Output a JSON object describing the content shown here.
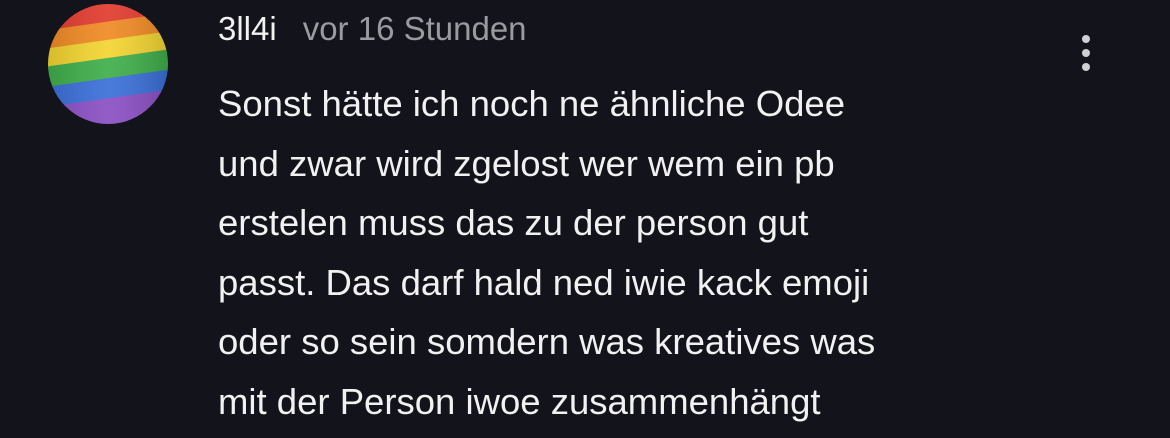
{
  "comment": {
    "avatar_icon": "rainbow-flag-avatar",
    "author": "3ll4i",
    "timestamp": "vor 16 Stunden",
    "menu_icon": "more-vertical-icon",
    "text_lines": [
      "Sonst hätte ich noch ne ähnliche Odee",
      "und zwar wird zgelost wer wem ein pb",
      "erstelen muss das zu der person gut",
      "passt. Das darf hald ned iwie kack emoji",
      "oder so sein somdern was kreatives was",
      "mit der Person iwoe zusammenhängt"
    ]
  },
  "colors": {
    "background": "#13131b",
    "text_primary": "#f1f1f1",
    "text_secondary": "#9a9aa0",
    "menu_dots": "#cfcfd4"
  }
}
